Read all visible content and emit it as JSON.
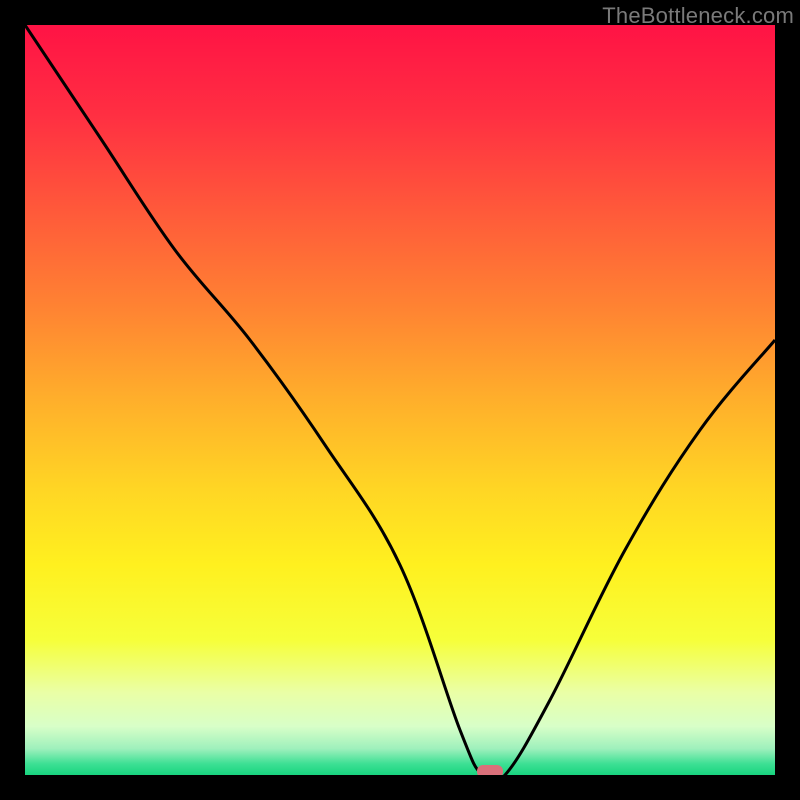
{
  "watermark": "TheBottleneck.com",
  "chart_data": {
    "type": "line",
    "title": "",
    "xlabel": "",
    "ylabel": "",
    "xlim": [
      0,
      100
    ],
    "ylim": [
      0,
      100
    ],
    "grid": false,
    "legend": false,
    "series": [
      {
        "name": "bottleneck-curve",
        "x": [
          0,
          10,
          20,
          30,
          40,
          50,
          58,
          61,
          64,
          70,
          80,
          90,
          100
        ],
        "y": [
          100,
          85,
          70,
          58,
          44,
          28,
          6,
          0,
          0,
          10,
          30,
          46,
          58
        ]
      }
    ],
    "marker": {
      "x": 62,
      "y": 0,
      "color": "#d9707a"
    },
    "gradient_stops": [
      {
        "offset": 0.0,
        "color": "#ff1345"
      },
      {
        "offset": 0.12,
        "color": "#ff2f42"
      },
      {
        "offset": 0.25,
        "color": "#ff5a3a"
      },
      {
        "offset": 0.38,
        "color": "#ff8432"
      },
      {
        "offset": 0.5,
        "color": "#ffaf2b"
      },
      {
        "offset": 0.62,
        "color": "#ffd624"
      },
      {
        "offset": 0.72,
        "color": "#fff01f"
      },
      {
        "offset": 0.82,
        "color": "#f6ff3a"
      },
      {
        "offset": 0.89,
        "color": "#eaffa6"
      },
      {
        "offset": 0.935,
        "color": "#d8ffc8"
      },
      {
        "offset": 0.965,
        "color": "#9ef0bc"
      },
      {
        "offset": 0.985,
        "color": "#3de094"
      },
      {
        "offset": 1.0,
        "color": "#18d47f"
      }
    ]
  }
}
